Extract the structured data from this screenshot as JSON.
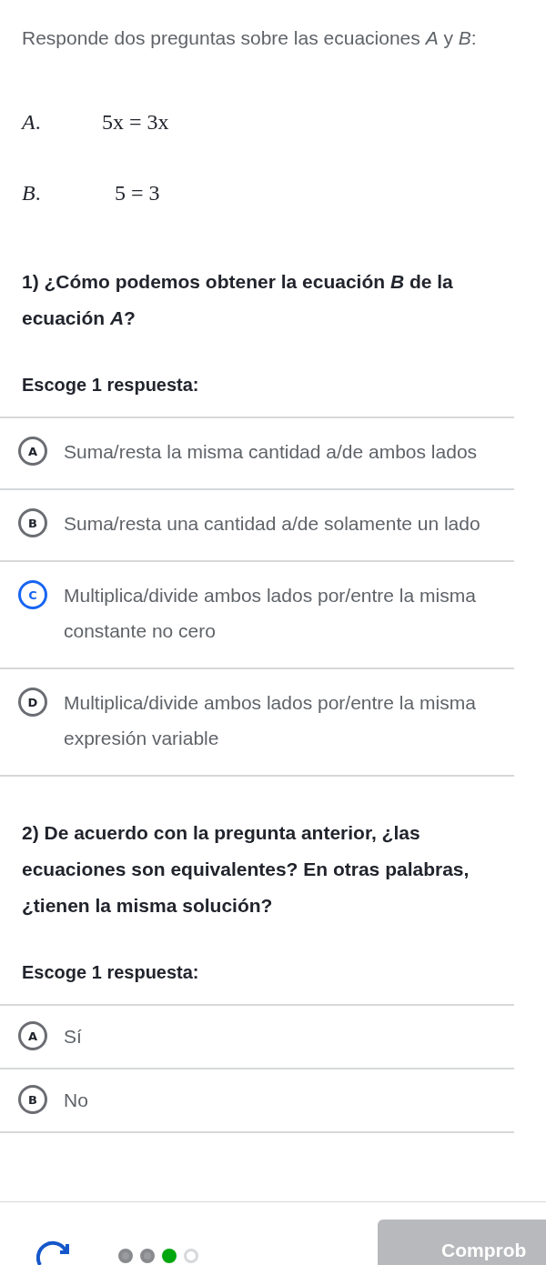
{
  "intro": "Responde dos preguntas sobre las ecuaciones *A* y *B*:",
  "equations": [
    {
      "label": "*A*.",
      "expression": "5x = 3x"
    },
    {
      "label": "*B*.",
      "expression": "5 = 3"
    }
  ],
  "questions": [
    {
      "prompt": "1) ¿Cómo podemos obtener la ecuación *B* de la ecuación *A*?",
      "instruction": "Escoge 1 respuesta:",
      "choices": [
        {
          "letter": "A",
          "text": "Suma/resta la misma cantidad a/de ambos lados",
          "selected": false
        },
        {
          "letter": "B",
          "text": "Suma/resta una cantidad a/de solamente un lado",
          "selected": false
        },
        {
          "letter": "C",
          "text": "Multiplica/divide ambos lados por/entre la misma constante no cero",
          "selected": true
        },
        {
          "letter": "D",
          "text": "Multiplica/divide ambos lados por/entre la misma expresión variable",
          "selected": false
        }
      ]
    },
    {
      "prompt": "2) De acuerdo con la pregunta anterior, ¿las ecuaciones son equivalentes? En otras palabras, ¿tienen la misma solución?",
      "instruction": "Escoge 1 respuesta:",
      "choices": [
        {
          "letter": "A",
          "text": "Sí",
          "selected": false
        },
        {
          "letter": "B",
          "text": "No",
          "selected": false
        }
      ]
    }
  ],
  "footer": {
    "progress": [
      {
        "kind": "done"
      },
      {
        "kind": "done"
      },
      {
        "kind": "current"
      },
      {
        "kind": "pending"
      }
    ],
    "check_button": {
      "label": "Comprob",
      "disabled": true
    }
  }
}
